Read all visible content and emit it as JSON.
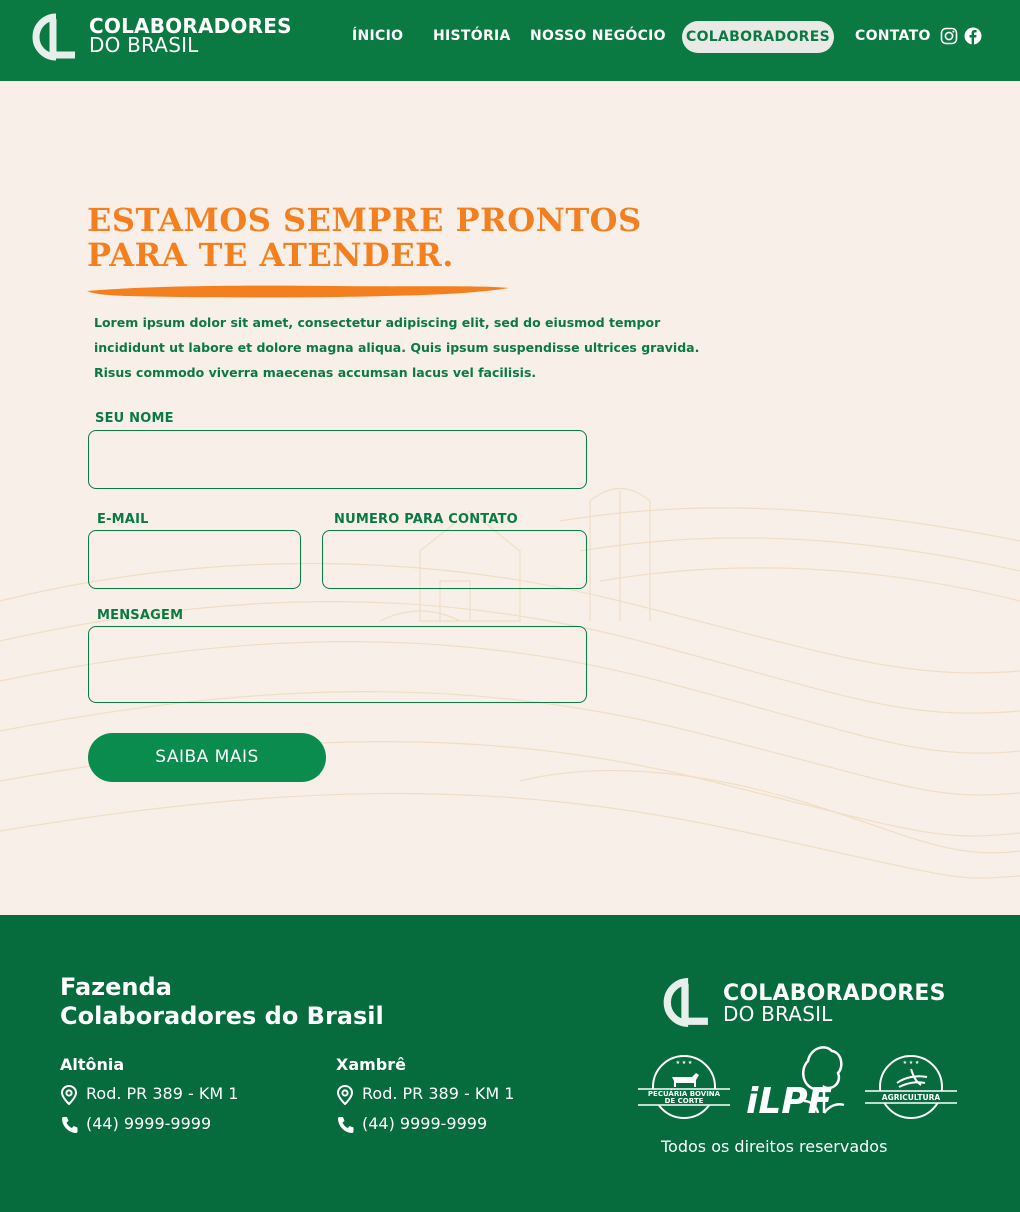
{
  "brand": {
    "line1": "COLABORADORES",
    "line2": "DO BRASIL",
    "mark": "CL"
  },
  "nav": {
    "items": [
      "ÍNICIO",
      "HISTÓRIA",
      "NOSSO NEGÓCIO"
    ],
    "active": "COLABORADORES",
    "contact": "CONTATO",
    "icons": [
      "instagram-icon",
      "facebook-icon"
    ]
  },
  "hero": {
    "heading_line1": "ESTAMOS SEMPRE PRONTOS",
    "heading_line2": "PARA TE ATENDER.",
    "intro_line1": "Lorem ipsum dolor sit amet, consectetur adipiscing elit, sed do eiusmod tempor",
    "intro_line2": "incididunt ut labore et dolore magna aliqua. Quis ipsum suspendisse ultrices gravida.",
    "intro_line3": "Risus commodo viverra maecenas accumsan lacus vel facilisis."
  },
  "form": {
    "name_label": "SEU NOME",
    "name_value": "",
    "email_label": "E-MAIL",
    "email_value": "",
    "phone_label": "NUMERO PARA CONTATO",
    "phone_value": "",
    "message_label": "MENSAGEM",
    "message_value": "",
    "submit_label": "SAIBA MAIS"
  },
  "footer": {
    "title_line1": "Fazenda",
    "title_line2": "Colaboradores do Brasil",
    "locations": [
      {
        "name": "Altônia",
        "address": "Rod. PR 389 - KM 1",
        "phone": "(44) 9999-9999"
      },
      {
        "name": "Xambrê",
        "address": "Rod. PR 389 - KM 1",
        "phone": "(44) 9999-9999"
      }
    ],
    "badges": [
      "PECUÁRIA BOVINA",
      "DE CORTE",
      "iLPF",
      "AGRICULTURA"
    ],
    "rights": "Todos os direitos reservados"
  },
  "colors": {
    "green": "#0a7a42",
    "footer_green": "#066b3d",
    "orange": "#f47f1f",
    "cream": "#f7efe8",
    "button": "#0a8c4f"
  }
}
